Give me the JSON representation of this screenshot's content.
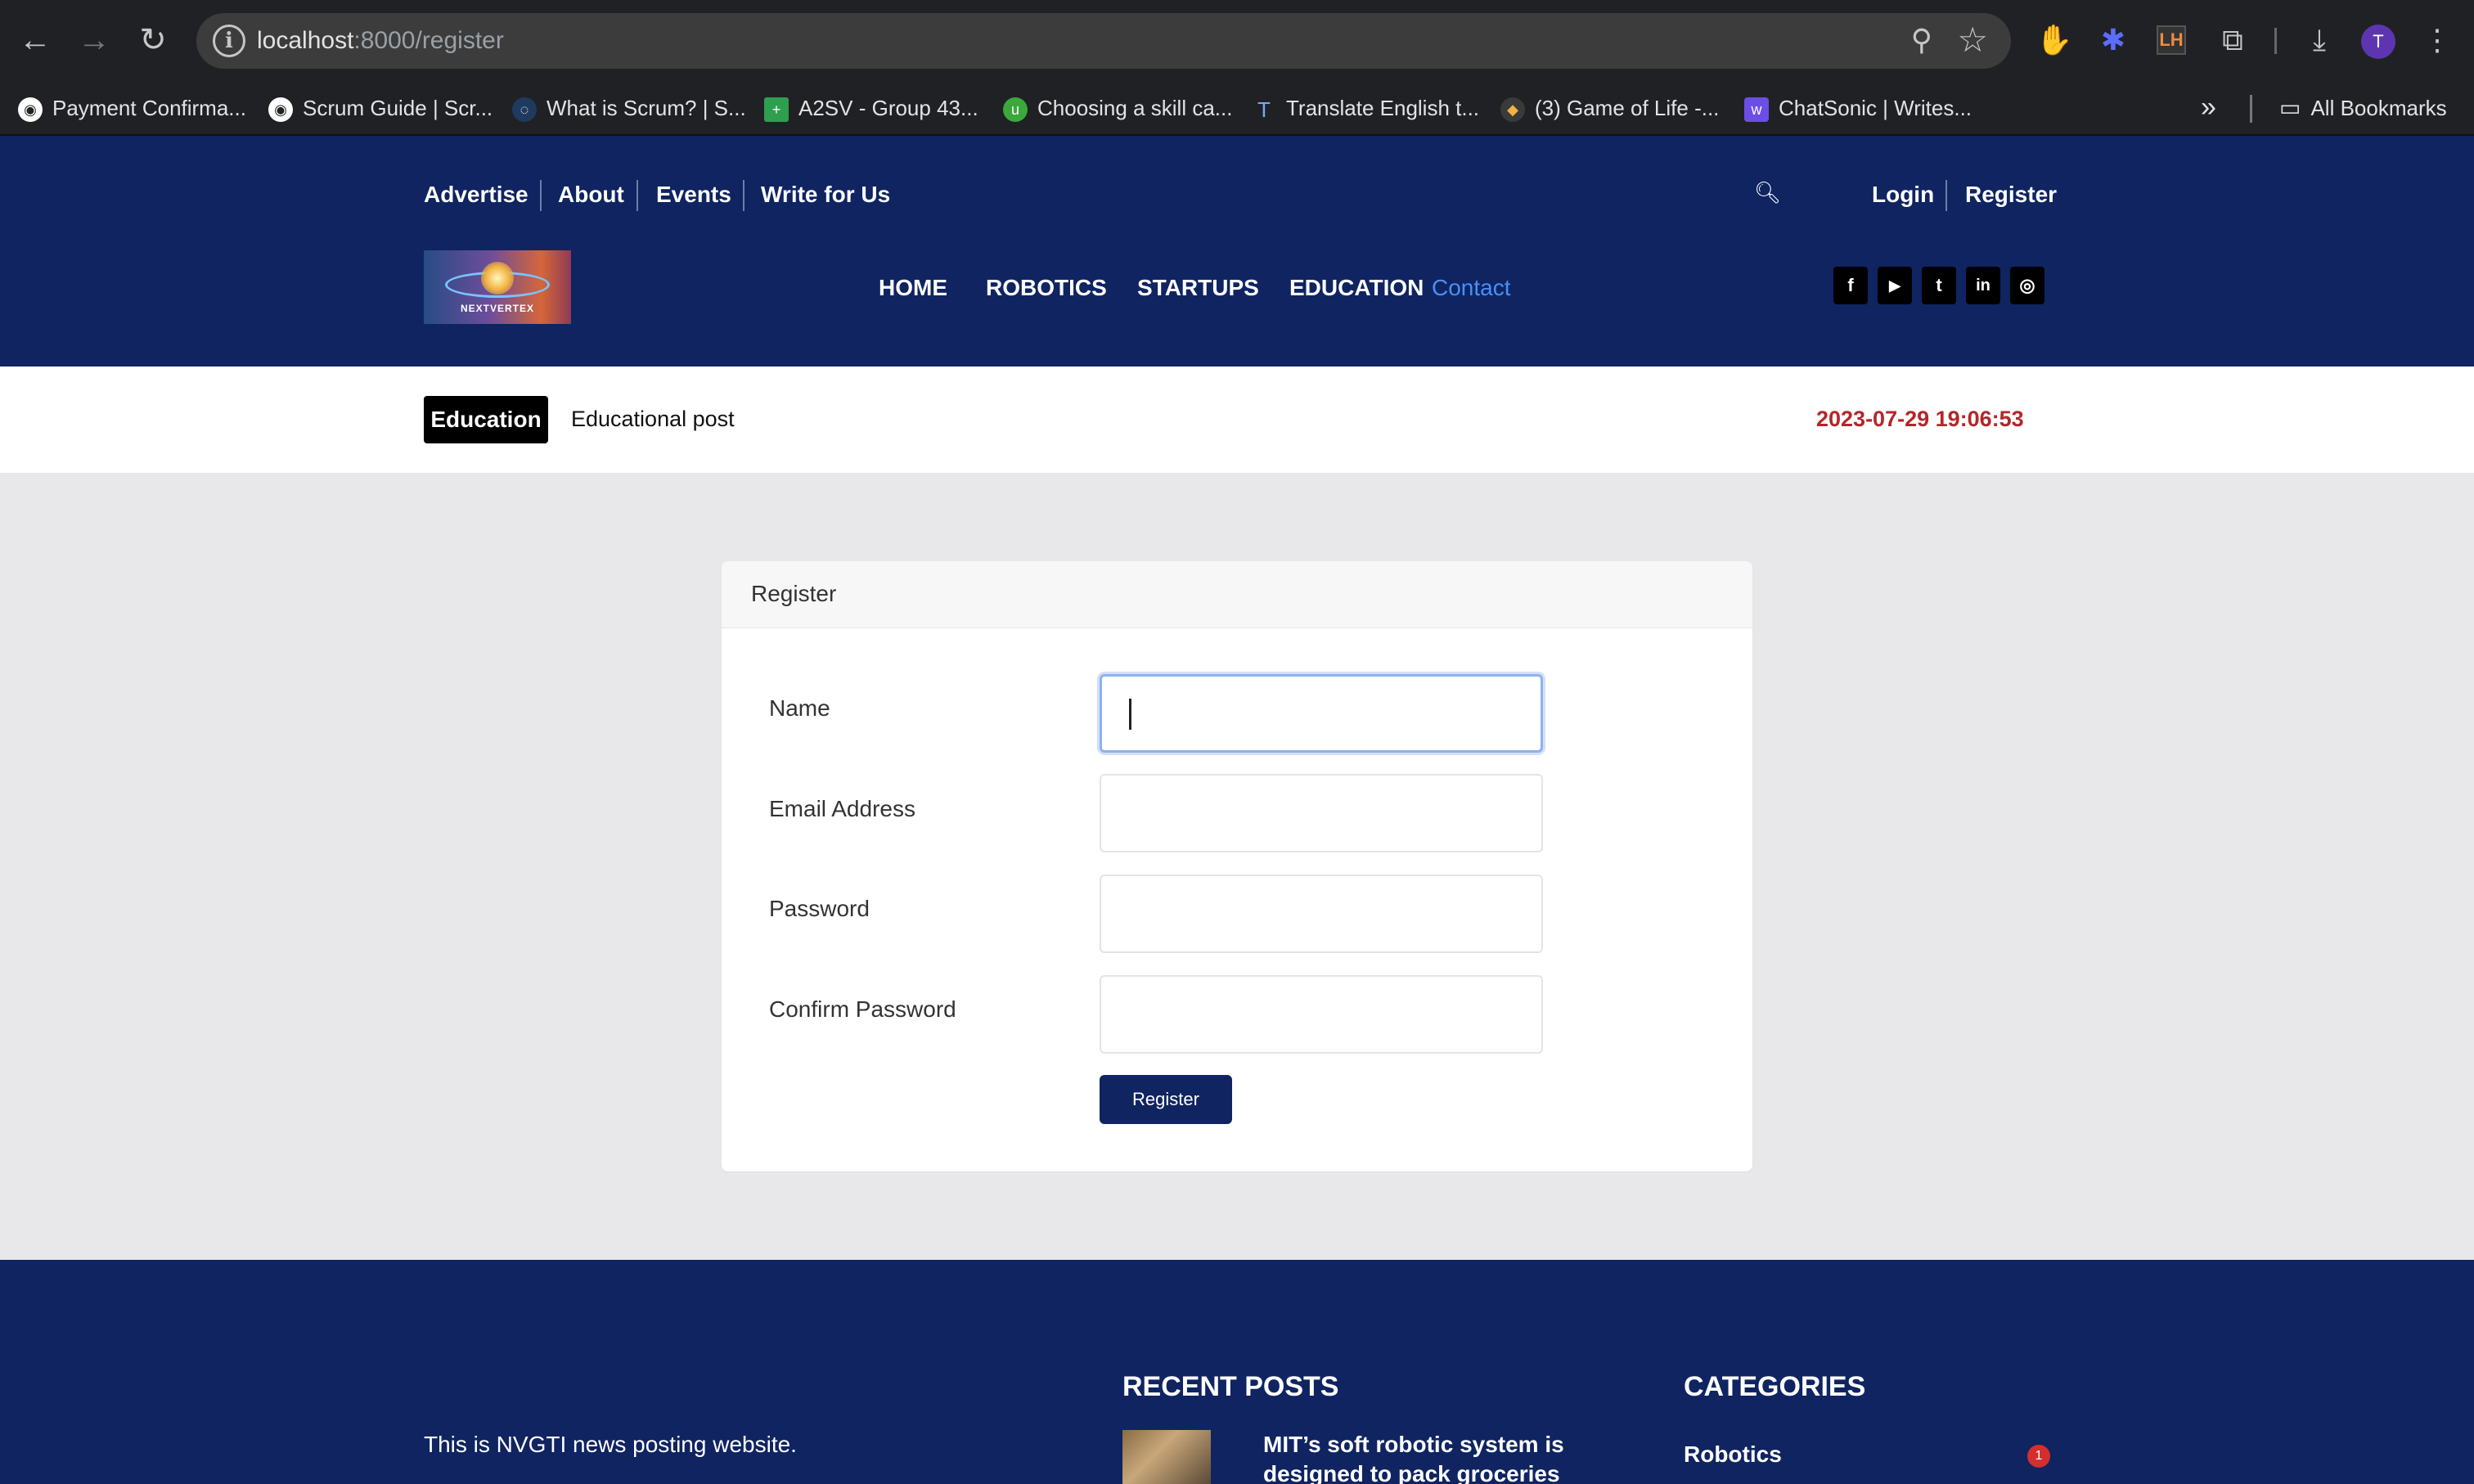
{
  "browser": {
    "url_host": "localhost",
    "url_path": ":8000/register",
    "profile_initial": "T",
    "bookmarks": [
      "Payment Confirma...",
      "Scrum Guide | Scr...",
      "What is Scrum? | S...",
      "A2SV - Group 43...",
      "Choosing a skill ca...",
      "Translate English t...",
      "(3) Game of Life -...",
      "ChatSonic | Writes..."
    ],
    "all_bookmarks": "All Bookmarks"
  },
  "header": {
    "top_links": [
      "Advertise",
      "About",
      "Events",
      "Write for Us"
    ],
    "login": "Login",
    "register": "Register",
    "logo_text": "NEXTVERTEX",
    "main_nav": [
      "HOME",
      "ROBOTICS",
      "STARTUPS",
      "EDUCATION",
      "Contact"
    ],
    "social": [
      "f",
      "▶",
      "t",
      "in",
      "◎"
    ]
  },
  "ticker": {
    "tag": "Education",
    "post": "Educational post",
    "date": "2023-07-29 19:06:53"
  },
  "form": {
    "title": "Register",
    "name_label": "Name",
    "name_value": "",
    "email_label": "Email Address",
    "email_value": "",
    "password_label": "Password",
    "password_value": "",
    "confirm_label": "Confirm Password",
    "confirm_value": "",
    "submit": "Register"
  },
  "footer": {
    "about": "This is NVGTI news posting website.",
    "recent_heading": "RECENT POSTS",
    "recent_post": "MIT’s soft robotic system is designed to pack groceries",
    "categories_heading": "CATEGORIES",
    "category": "Robotics",
    "category_count": "1"
  }
}
